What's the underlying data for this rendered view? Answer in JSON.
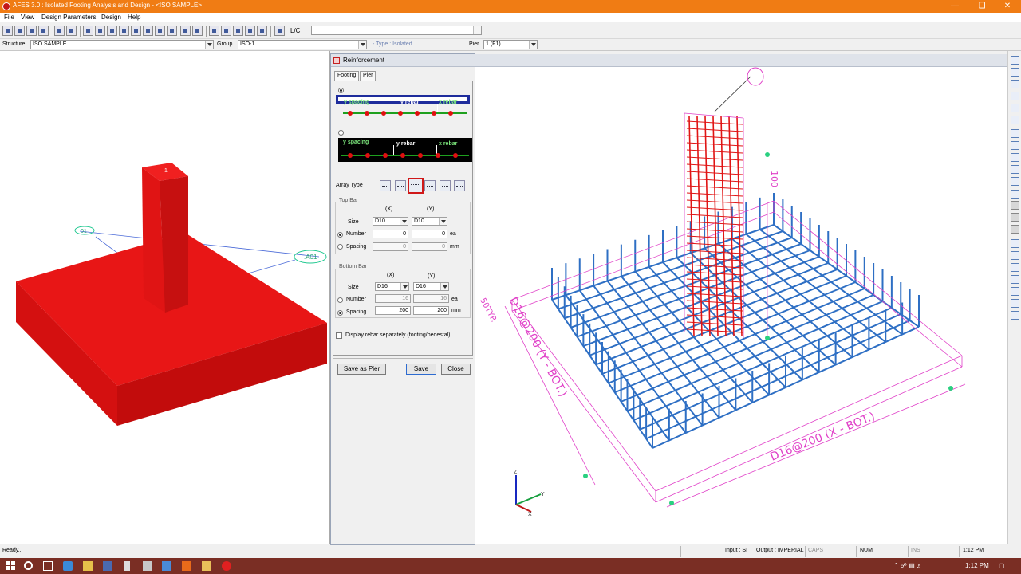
{
  "window": {
    "title": "AFES 3.0 : Isolated Footing Analysis and Design - <ISO SAMPLE>"
  },
  "menu": [
    "File",
    "View",
    "Design Parameters",
    "Design",
    "Help"
  ],
  "toolbar": {
    "lc_label": "L/C",
    "lc_value": ""
  },
  "structure_bar": {
    "structure_label": "Structure",
    "structure_value": "ISO SAMPLE",
    "group_label": "Group",
    "group_value": "ISO-1",
    "type_text": "- Type : Isolated",
    "pier_label": "Pier",
    "pier_value": "1 (F1)"
  },
  "left_view": {
    "pier_tag": "1",
    "label_a": ".A01",
    "label_b": "01"
  },
  "dialog": {
    "title": "Reinforcement",
    "tabs": [
      "Footing",
      "Pier"
    ],
    "option1": {
      "spacing": "y spacing",
      "yrebar": "y rebar",
      "xrebar": "x rebar"
    },
    "option2": {
      "spacing": "y spacing",
      "yrebar": "y rebar",
      "xrebar": "x rebar"
    },
    "array_type_label": "Array Type",
    "top_bar": {
      "label": "Top Bar",
      "col_x": "(X)",
      "col_y": "(Y)",
      "size_label": "Size",
      "size_x": "D10",
      "size_y": "D10",
      "number_label": "Number",
      "number_x": "0",
      "number_y": "0",
      "number_unit": "ea",
      "spacing_label": "Spacing",
      "spacing_x": "0",
      "spacing_y": "0",
      "spacing_unit": "mm"
    },
    "bottom_bar": {
      "label": "Bottom Bar",
      "col_x": "(X)",
      "col_y": "(Y)",
      "size_label": "Size",
      "size_x": "D16",
      "size_y": "D16",
      "number_label": "Number",
      "number_x": "16",
      "number_y": "16",
      "number_unit": "ea",
      "spacing_label": "Spacing",
      "spacing_x": "200",
      "spacing_y": "200",
      "spacing_unit": "mm"
    },
    "display_separately": "Display rebar separately (footing/pedestal)",
    "buttons": {
      "save_as_pier": "Save as Pier",
      "save": "Save",
      "close": "Close"
    }
  },
  "right_view": {
    "bot_y": "D16@200 (Y - BOT.)",
    "bot_x": "D16@200 (X - BOT.)",
    "typ": "50TYP.",
    "dim_100": "100",
    "axis_z": "Z",
    "axis_y": "Y",
    "axis_x": "X"
  },
  "status": {
    "ready": "Ready...",
    "input": "Input : SI",
    "output": "Output : IMPERIAL",
    "caps": "CAPS",
    "num": "NUM",
    "ins": "INS",
    "time": "1:12 PM"
  },
  "taskbar": {
    "time": "1:12 PM"
  },
  "colors": {
    "title_orange": "#f07c14",
    "solid_red": "#e01414",
    "rebar_blue": "#2e6fc4",
    "dim_magenta": "#e040c8"
  }
}
